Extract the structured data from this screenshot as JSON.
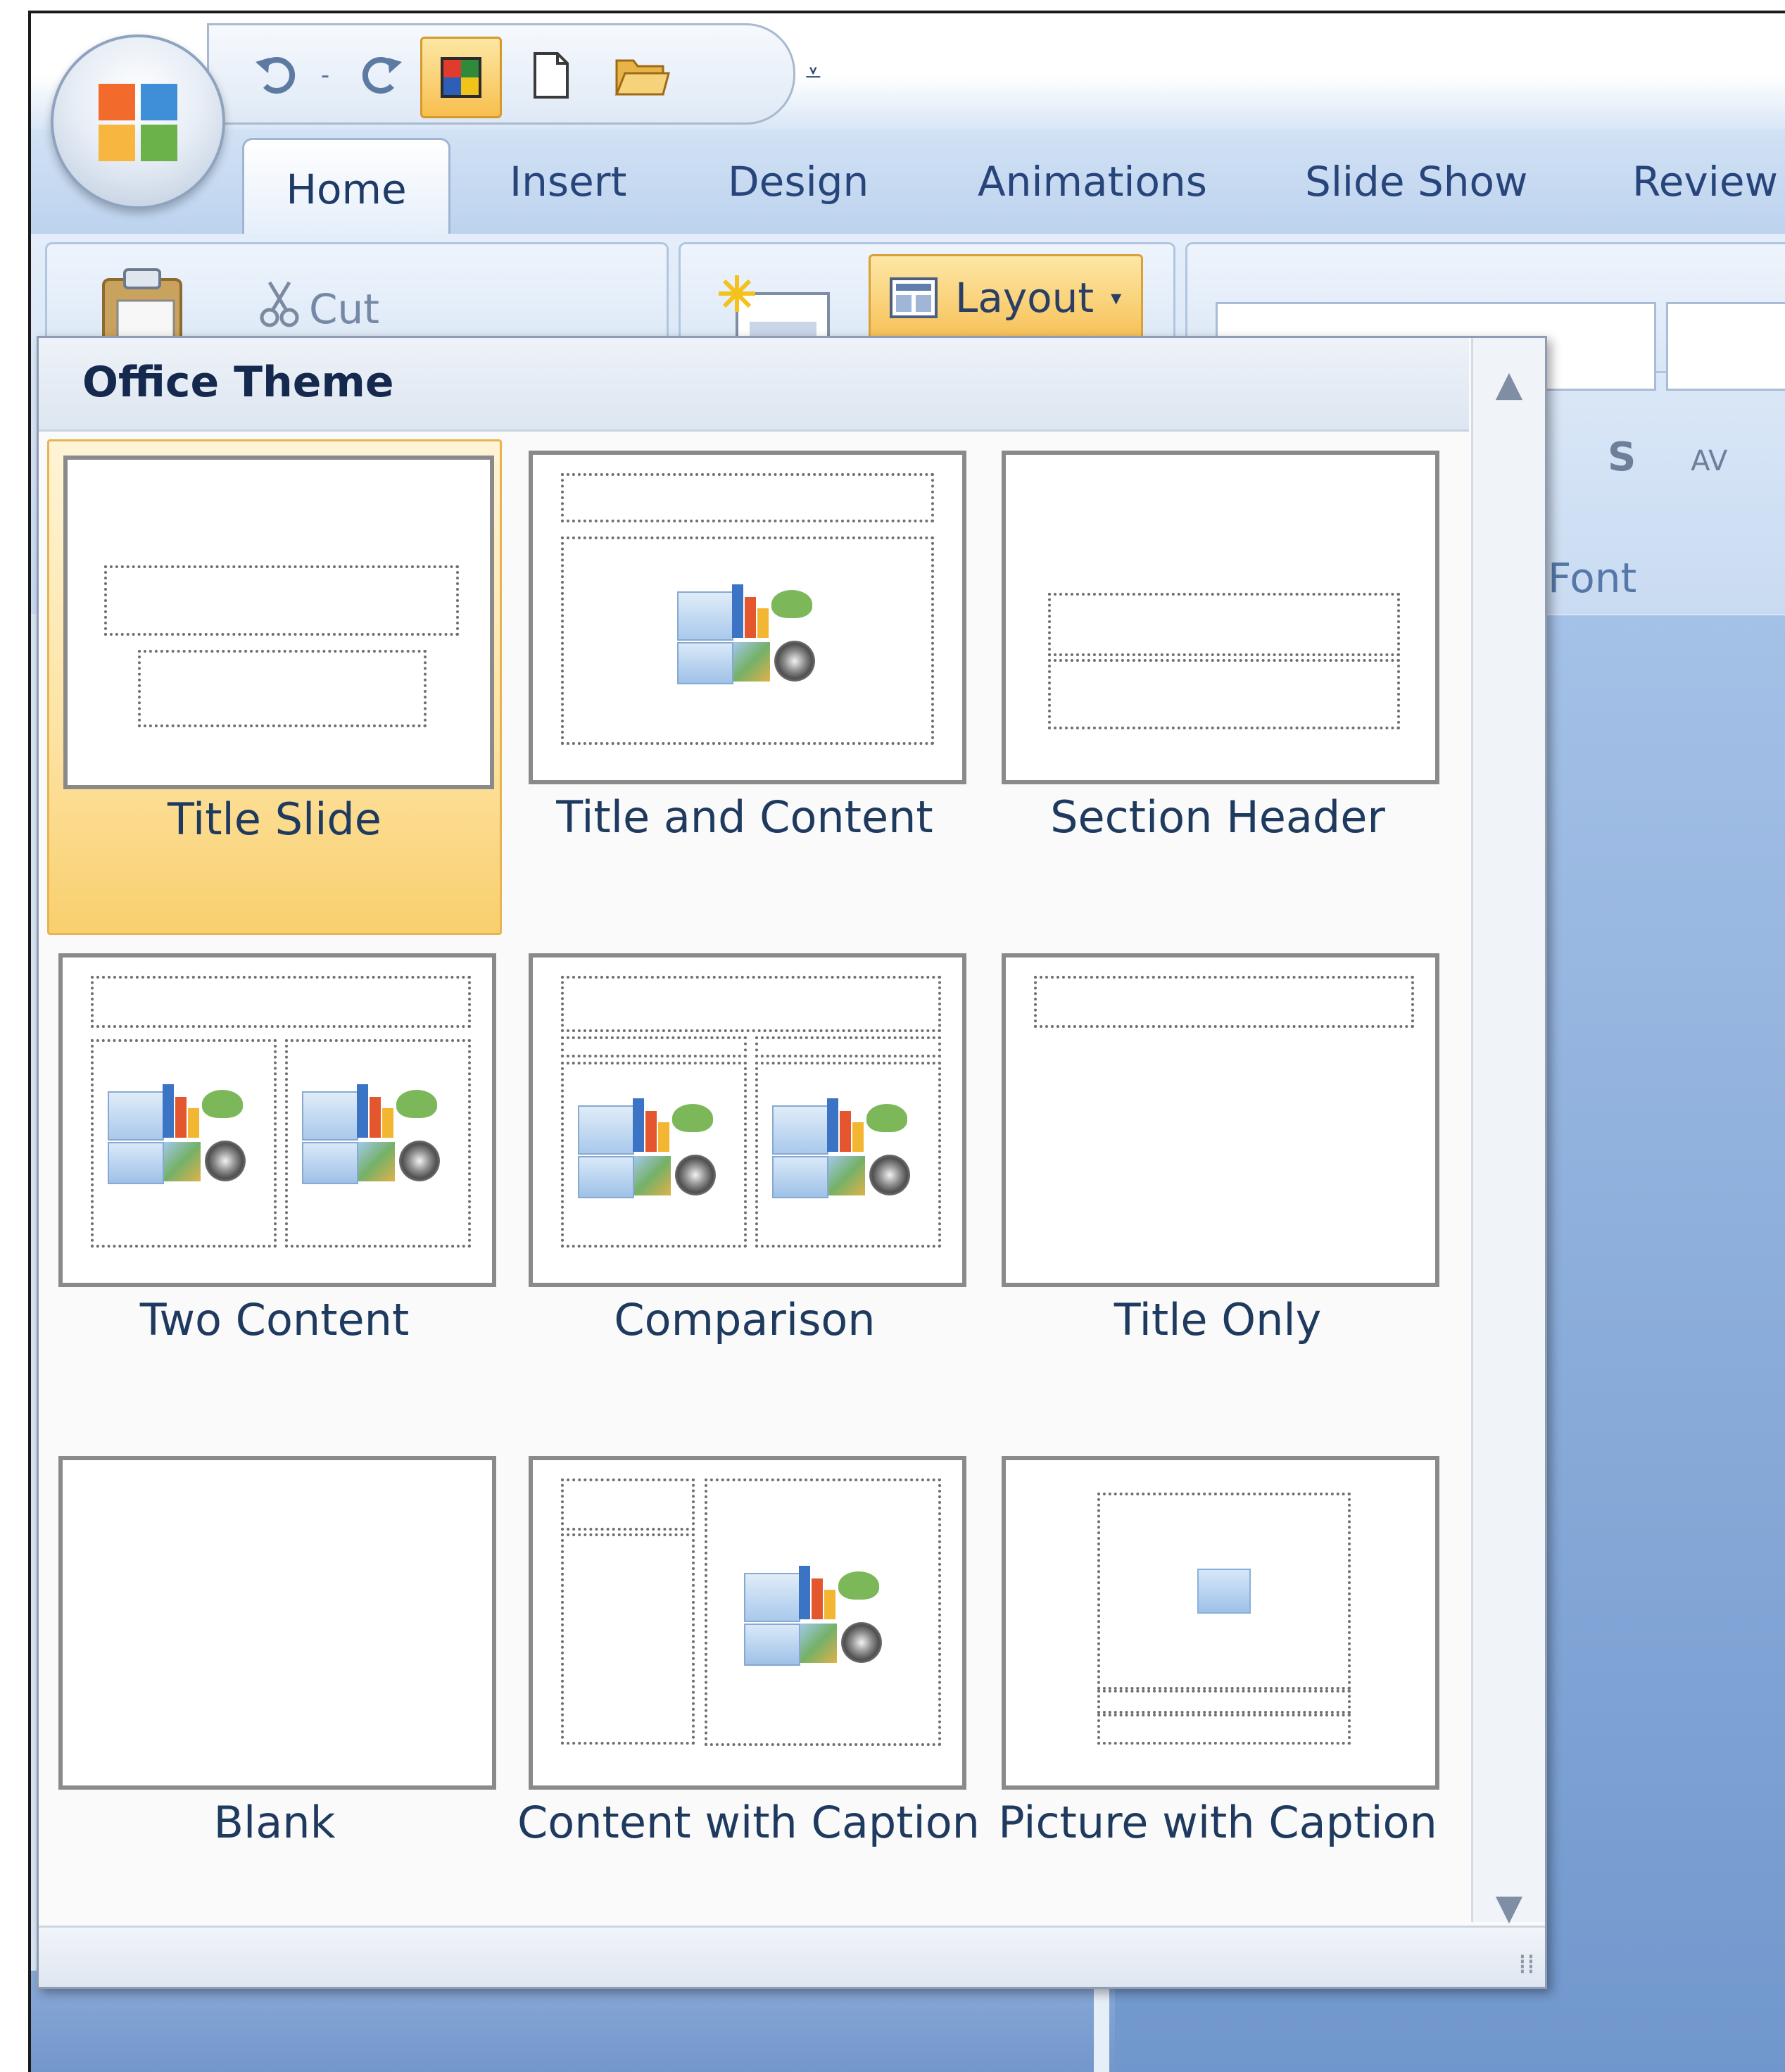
{
  "quick_access": {
    "buttons": [
      {
        "name": "undo",
        "icon": "undo-icon"
      },
      {
        "name": "undo-dropdown",
        "icon": "chevron-down-icon"
      },
      {
        "name": "redo",
        "icon": "redo-icon"
      },
      {
        "name": "theme",
        "icon": "theme-icon"
      },
      {
        "name": "new",
        "icon": "new-document-icon"
      },
      {
        "name": "open",
        "icon": "open-folder-icon"
      }
    ],
    "customize_glyph": "⩡"
  },
  "tabs": [
    "Home",
    "Insert",
    "Design",
    "Animations",
    "Slide Show",
    "Review"
  ],
  "ribbon": {
    "cut_label": "Cut",
    "layout_label": "Layout",
    "font_group_label": "Font"
  },
  "gallery": {
    "title": "Office Theme",
    "layouts": [
      {
        "label": "Title Slide"
      },
      {
        "label": "Title and Content"
      },
      {
        "label": "Section Header"
      },
      {
        "label": "Two Content"
      },
      {
        "label": "Comparison"
      },
      {
        "label": "Title Only"
      },
      {
        "label": "Blank"
      },
      {
        "label": "Content with Caption"
      },
      {
        "label": "Picture with Caption"
      }
    ],
    "selected": "Title Slide"
  },
  "colors": {
    "accent_orange": "#f7c157",
    "ribbon_blue": "#bcd2ee",
    "label_text": "#1f3a5f"
  }
}
